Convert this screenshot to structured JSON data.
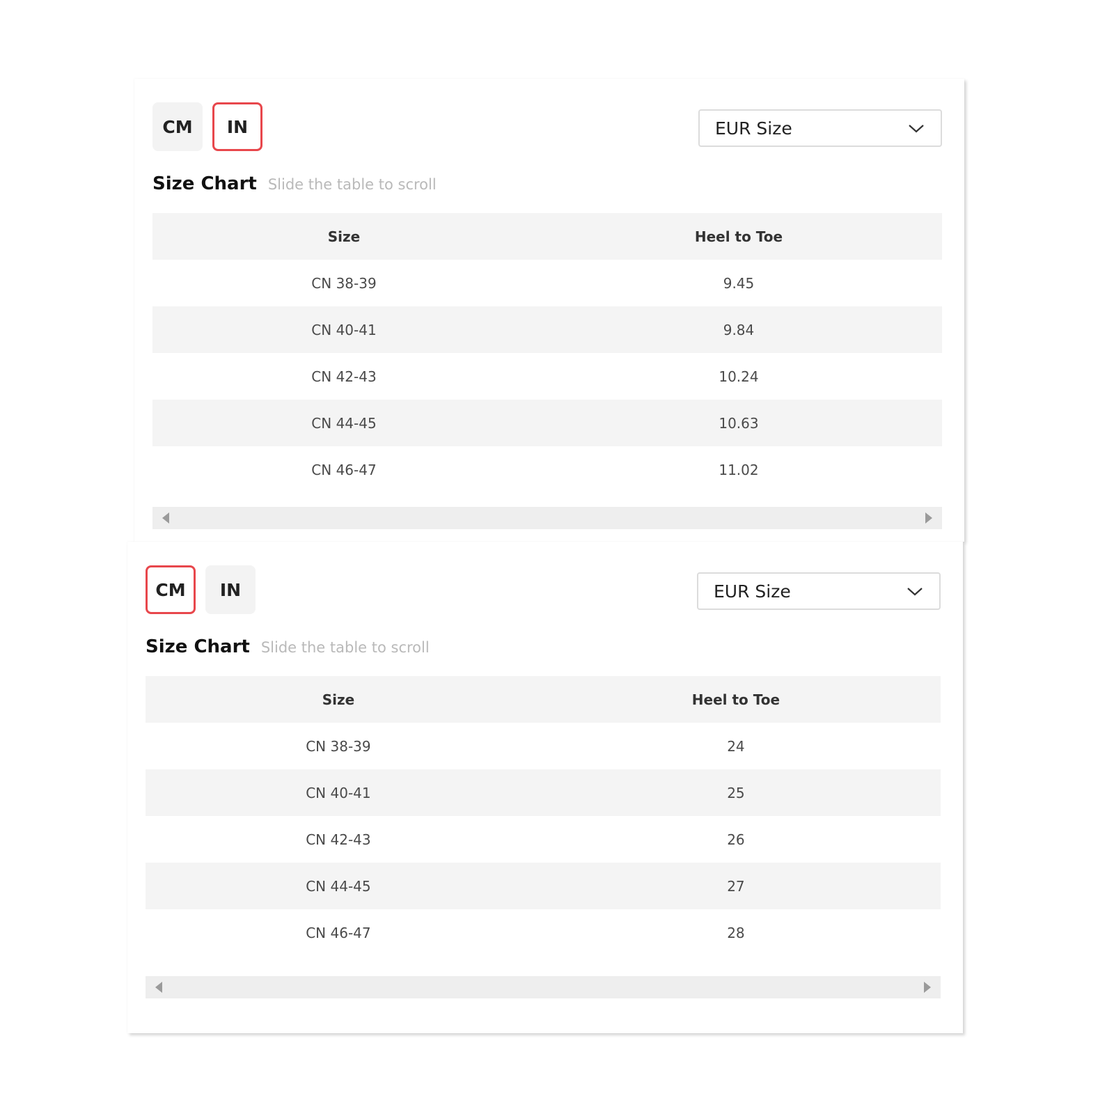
{
  "panels": [
    {
      "unit_buttons": [
        {
          "label": "CM",
          "active": false
        },
        {
          "label": "IN",
          "active": true
        }
      ],
      "size_select": {
        "value": "EUR Size"
      },
      "title": "Size Chart",
      "hint": "Slide the table to scroll",
      "columns": [
        "Size",
        "Heel to Toe"
      ],
      "rows": [
        [
          "CN 38-39",
          "9.45"
        ],
        [
          "CN 40-41",
          "9.84"
        ],
        [
          "CN 42-43",
          "10.24"
        ],
        [
          "CN 44-45",
          "10.63"
        ],
        [
          "CN 46-47",
          "11.02"
        ]
      ]
    },
    {
      "unit_buttons": [
        {
          "label": "CM",
          "active": true
        },
        {
          "label": "IN",
          "active": false
        }
      ],
      "size_select": {
        "value": "EUR Size"
      },
      "title": "Size Chart",
      "hint": "Slide the table to scroll",
      "columns": [
        "Size",
        "Heel to Toe"
      ],
      "rows": [
        [
          "CN 38-39",
          "24"
        ],
        [
          "CN 40-41",
          "25"
        ],
        [
          "CN 42-43",
          "26"
        ],
        [
          "CN 44-45",
          "27"
        ],
        [
          "CN 46-47",
          "28"
        ]
      ]
    }
  ],
  "colors": {
    "active_border": "#e8474c",
    "button_bg": "#f3f3f3",
    "stripe_bg": "#f4f4f4",
    "hint_text": "#b9b9b9"
  },
  "icons": {
    "dropdown": "chevron-down-icon",
    "scroll_left": "scroll-left-arrow-icon",
    "scroll_right": "scroll-right-arrow-icon"
  }
}
